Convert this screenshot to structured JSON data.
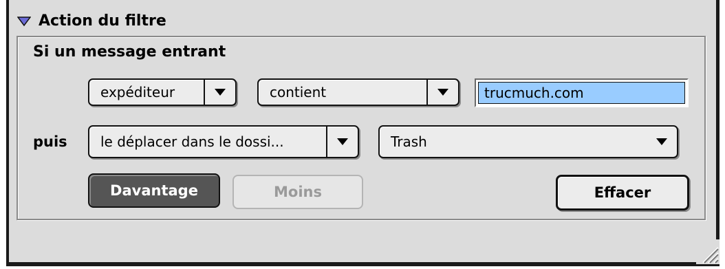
{
  "section": {
    "title": "Action du filtre",
    "icon": "disclosure-triangle-icon"
  },
  "condition": {
    "group_title": "Si un message entrant",
    "field_popup": "expéditeur",
    "operator_popup": "contient",
    "value_field": "trucmuch.com"
  },
  "action": {
    "then_label": "puis",
    "action_popup": "le déplacer dans le dossi...",
    "folder_popup": "Trash"
  },
  "buttons": {
    "more": "Davantage",
    "less": "Moins",
    "clear": "Effacer"
  },
  "colors": {
    "window_bg": "#dcdcdc",
    "selection_bg": "#99ccff",
    "default_button_bg": "#555555",
    "disclosure_triangle": "#6b6bd6"
  },
  "icons": {
    "popup_arrow": "chevron-down-icon",
    "resize": "resize-grip-icon"
  }
}
